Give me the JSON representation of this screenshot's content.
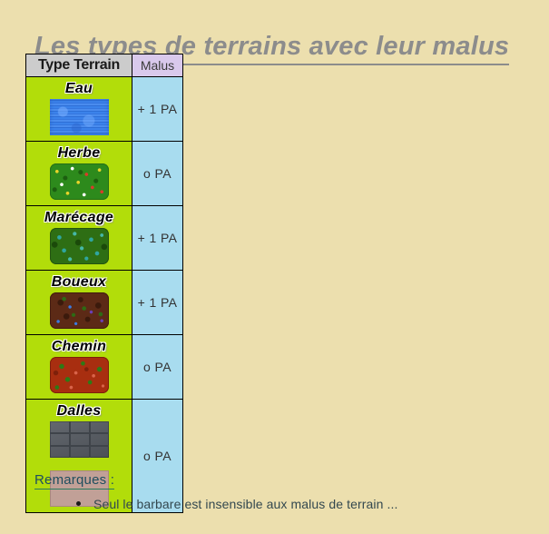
{
  "title": "Les types de terrains avec leur malus",
  "table": {
    "headers": {
      "terrain": "Type Terrain",
      "malus": "Malus"
    },
    "rows": [
      {
        "name": "Eau",
        "malus": "+ 1 PA",
        "tile": "water-tile"
      },
      {
        "name": "Herbe",
        "malus": "o PA",
        "tile": "grass-tile"
      },
      {
        "name": "Marécage",
        "malus": "+ 1 PA",
        "tile": "swamp-tile"
      },
      {
        "name": "Boueux",
        "malus": "+ 1 PA",
        "tile": "mud-tile"
      },
      {
        "name": "Chemin",
        "malus": "o PA",
        "tile": "path-tile"
      },
      {
        "name": "Dalles",
        "malus": "o PA",
        "tile": "slabs-tile"
      }
    ]
  },
  "remarks": {
    "title": "Remarques :",
    "items": [
      "Seul le barbare est insensible aux malus de terrain ..."
    ]
  },
  "colors": {
    "page_background": "#ecdfae",
    "title_text": "#8c8c8c",
    "terrain_cell": "#b2dd0a",
    "malus_cell": "#a8dcef",
    "header_terrain": "#cccccc",
    "header_malus": "#d9c9ec",
    "remarks_title": "#1f4e5f",
    "remarks_text": "#33484f",
    "border": "#000000"
  }
}
